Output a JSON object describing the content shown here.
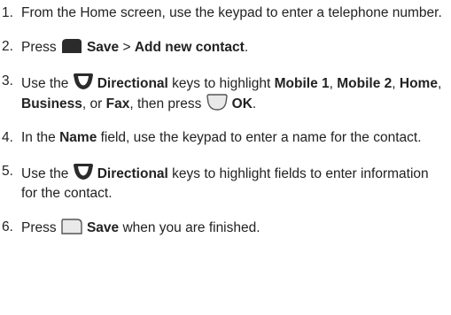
{
  "steps": [
    {
      "num": "1.",
      "text": "From the Home screen, use the keypad to enter a telephone number."
    },
    {
      "num": "2.",
      "pre": "Press ",
      "save": "Save",
      "sep": " > ",
      "add_contact": "Add new contact",
      "end": "."
    },
    {
      "num": "3.",
      "pre": "Use the ",
      "directional": "Directional",
      "mid": " keys to highlight ",
      "mobile1": "Mobile 1",
      "c1": ", ",
      "mobile2": "Mobile 2",
      "c2": ", ",
      "home": "Home",
      "c3": ", ",
      "business": "Business",
      "c4": ", or ",
      "fax": "Fax",
      "then": ", then press ",
      "ok": "OK",
      "end": "."
    },
    {
      "num": "4.",
      "pre": "In the ",
      "name_field": "Name",
      "post": " field, use the keypad to enter a name for the contact."
    },
    {
      "num": "5.",
      "pre": "Use the ",
      "directional": "Directional",
      "post": " keys to highlight fields to enter information for the contact."
    },
    {
      "num": "6.",
      "pre": "Press ",
      "save": "Save",
      "post": " when you are finished."
    }
  ],
  "icons": {
    "left_softkey": "left-softkey-icon",
    "directional_key": "directional-key-icon",
    "center_key": "center-ok-key-icon",
    "right_softkey": "right-softkey-icon"
  },
  "colors": {
    "text": "#222222",
    "icon_fill": "#2b2b2b",
    "key_fill": "#e9e9e9",
    "key_stroke": "#555555"
  }
}
